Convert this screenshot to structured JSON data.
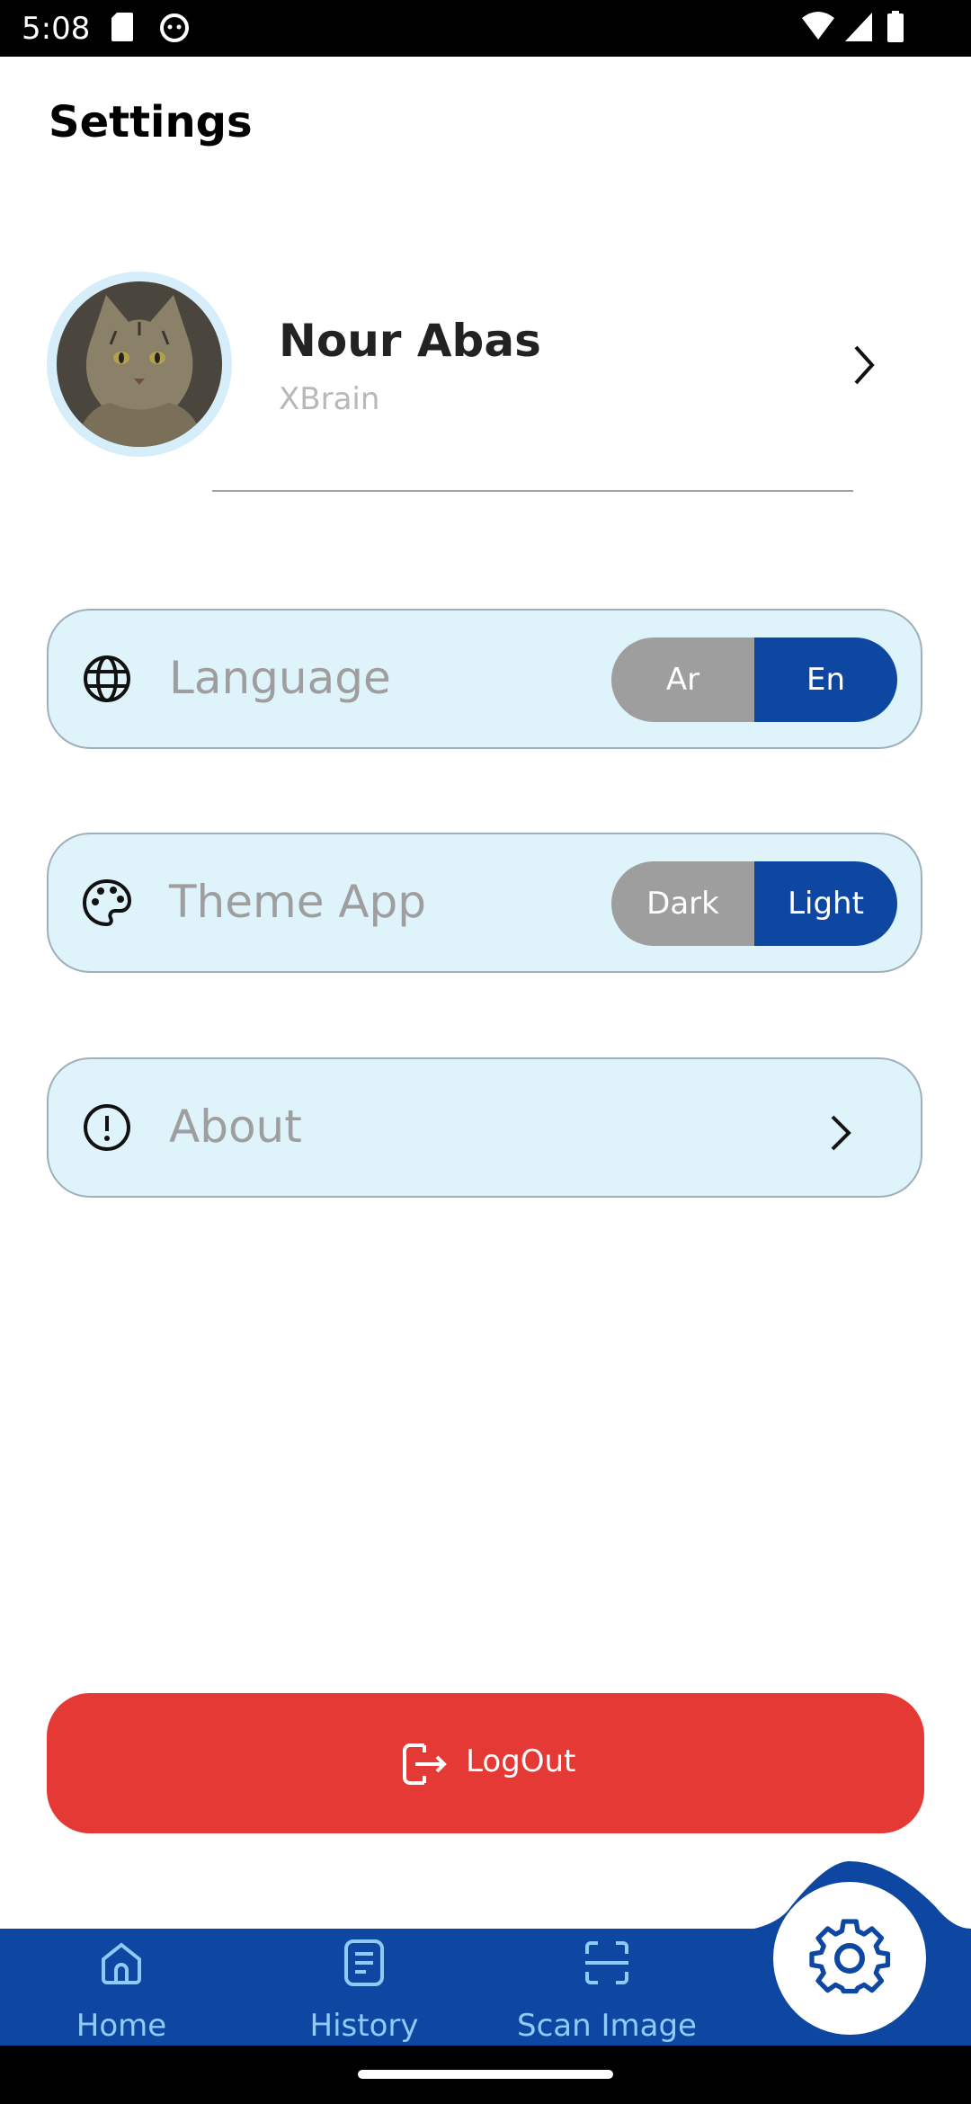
{
  "status_bar": {
    "time": "5:08"
  },
  "page": {
    "title": "Settings"
  },
  "profile": {
    "name": "Nour Abas",
    "subtitle": "XBrain"
  },
  "settings": {
    "language": {
      "label": "Language",
      "options": [
        "Ar",
        "En"
      ],
      "selected": "En"
    },
    "theme": {
      "label": "Theme App",
      "options": [
        "Dark",
        "Light"
      ],
      "selected": "Light"
    },
    "about": {
      "label": "About"
    }
  },
  "logout": {
    "label": "LogOut"
  },
  "bottom_nav": {
    "items": [
      {
        "label": "Home",
        "icon": "home-icon"
      },
      {
        "label": "History",
        "icon": "history-icon"
      },
      {
        "label": "Scan Image",
        "icon": "scan-icon"
      }
    ],
    "active": "settings",
    "active_icon": "gear-icon"
  },
  "colors": {
    "primary": "#0d47a1",
    "card_bg": "#dff3fb",
    "logout": "#e53935",
    "toggle_off": "#9e9e9e"
  }
}
